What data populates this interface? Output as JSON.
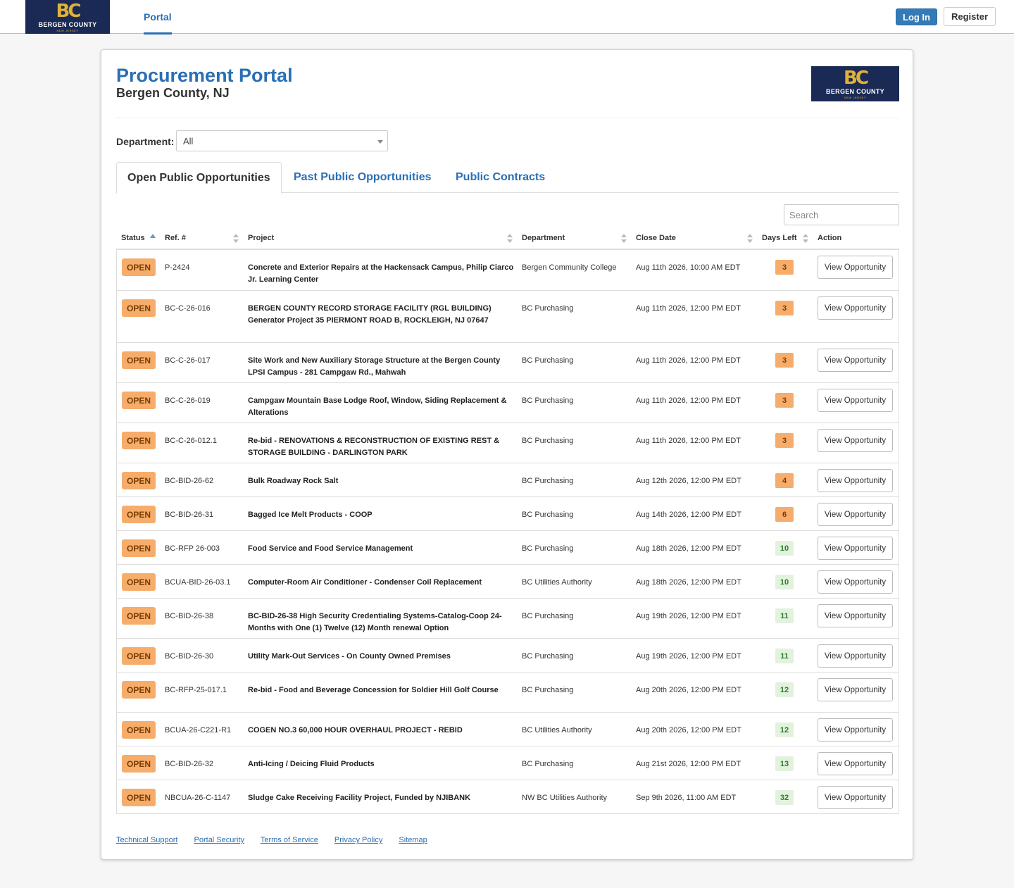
{
  "nav": {
    "logo": {
      "mark": "BC",
      "name": "BERGEN COUNTY",
      "sub": "NEW JERSEY"
    },
    "portal_link": "Portal",
    "login_label": "Log In",
    "register_label": "Register"
  },
  "header": {
    "title": "Procurement Portal",
    "subtitle": "Bergen County, NJ"
  },
  "filter": {
    "department_label": "Department:",
    "department_value": "All"
  },
  "tabs": [
    {
      "label": "Open Public Opportunities",
      "active": true
    },
    {
      "label": "Past Public Opportunities",
      "active": false
    },
    {
      "label": "Public Contracts",
      "active": false
    }
  ],
  "search": {
    "placeholder": "Search"
  },
  "table": {
    "columns": [
      "Status",
      "Ref. #",
      "Project",
      "Department",
      "Close Date",
      "Days Left",
      "Action"
    ],
    "action_label": "View Opportunity",
    "rows": [
      {
        "status": "OPEN",
        "ref": "P-2424",
        "project": "Concrete and Exterior Repairs at the Hackensack Campus, Philip Ciarco Jr. Learning Center",
        "dept": "Bergen Community College",
        "close": "Aug 11th 2026, 10:00 AM EDT",
        "days": "3",
        "urgent": true,
        "lines": 2
      },
      {
        "status": "OPEN",
        "ref": "BC-C-26-016",
        "project": "BERGEN COUNTY RECORD STORAGE FACILITY (RGL BUILDING) Generator Project 35 PIERMONT ROAD B, ROCKLEIGH, NJ 07647",
        "dept": "BC Purchasing",
        "close": "Aug 11th 2026, 12:00 PM EDT",
        "days": "3",
        "urgent": true,
        "lines": 3
      },
      {
        "status": "OPEN",
        "ref": "BC-C-26-017",
        "project": "Site Work and New Auxiliary Storage Structure at the Bergen County LPSI Campus - 281 Campgaw Rd., Mahwah",
        "dept": "BC Purchasing",
        "close": "Aug 11th 2026, 12:00 PM EDT",
        "days": "3",
        "urgent": true,
        "lines": 2
      },
      {
        "status": "OPEN",
        "ref": "BC-C-26-019",
        "project": "Campgaw Mountain Base Lodge Roof, Window, Siding Replacement & Alterations",
        "dept": "BC Purchasing",
        "close": "Aug 11th 2026, 12:00 PM EDT",
        "days": "3",
        "urgent": true,
        "lines": 2
      },
      {
        "status": "OPEN",
        "ref": "BC-C-26-012.1",
        "project": "Re-bid - RENOVATIONS & RECONSTRUCTION OF EXISTING REST & STORAGE BUILDING - DARLINGTON PARK",
        "dept": "BC Purchasing",
        "close": "Aug 11th 2026, 12:00 PM EDT",
        "days": "3",
        "urgent": true,
        "lines": 2
      },
      {
        "status": "OPEN",
        "ref": "BC-BID-26-62",
        "project": "Bulk Roadway Rock Salt",
        "dept": "BC Purchasing",
        "close": "Aug 12th 2026, 12:00 PM EDT",
        "days": "4",
        "urgent": true,
        "lines": 1
      },
      {
        "status": "OPEN",
        "ref": "BC-BID-26-31",
        "project": "Bagged Ice Melt Products - COOP",
        "dept": "BC Purchasing",
        "close": "Aug 14th 2026, 12:00 PM EDT",
        "days": "6",
        "urgent": true,
        "lines": 1
      },
      {
        "status": "OPEN",
        "ref": "BC-RFP 26-003",
        "project": "Food Service and Food Service Management",
        "dept": "BC Purchasing",
        "close": "Aug 18th 2026, 12:00 PM EDT",
        "days": "10",
        "urgent": false,
        "lines": 1
      },
      {
        "status": "OPEN",
        "ref": "BCUA-BID-26-03.1",
        "project": "Computer-Room Air Conditioner - Condenser Coil Replacement",
        "dept": "BC Utilities Authority",
        "close": "Aug 18th 2026, 12:00 PM EDT",
        "days": "10",
        "urgent": false,
        "lines": 1
      },
      {
        "status": "OPEN",
        "ref": "BC-BID-26-38",
        "project": "BC-BID-26-38 High Security Credentialing Systems-Catalog-Coop 24-Months with One (1) Twelve (12) Month renewal Option",
        "dept": "BC Purchasing",
        "close": "Aug 19th 2026, 12:00 PM EDT",
        "days": "11",
        "urgent": false,
        "lines": 2
      },
      {
        "status": "OPEN",
        "ref": "BC-BID-26-30",
        "project": "Utility Mark-Out Services - On County Owned Premises",
        "dept": "BC Purchasing",
        "close": "Aug 19th 2026, 12:00 PM EDT",
        "days": "11",
        "urgent": false,
        "lines": 1
      },
      {
        "status": "OPEN",
        "ref": "BC-RFP-25-017.1",
        "project": "Re-bid - Food and Beverage Concession for Soldier Hill Golf Course",
        "dept": "BC Purchasing",
        "close": "Aug 20th 2026, 12:00 PM EDT",
        "days": "12",
        "urgent": false,
        "lines": 2
      },
      {
        "status": "OPEN",
        "ref": "BCUA-26-C221-R1",
        "project": "COGEN NO.3 60,000 HOUR OVERHAUL PROJECT - REBID",
        "dept": "BC Utilities Authority",
        "close": "Aug 20th 2026, 12:00 PM EDT",
        "days": "12",
        "urgent": false,
        "lines": 1
      },
      {
        "status": "OPEN",
        "ref": "BC-BID-26-32",
        "project": "Anti-Icing / Deicing Fluid Products",
        "dept": "BC Purchasing",
        "close": "Aug 21st 2026, 12:00 PM EDT",
        "days": "13",
        "urgent": false,
        "lines": 1
      },
      {
        "status": "OPEN",
        "ref": "NBCUA-26-C-1147",
        "project": "Sludge Cake Receiving Facility Project, Funded by NJIBANK",
        "dept": "NW BC Utilities Authority",
        "close": "Sep 9th 2026, 11:00 AM EDT",
        "days": "32",
        "urgent": false,
        "lines": 1
      }
    ]
  },
  "footer": {
    "links": [
      "Technical Support",
      "Portal Security",
      "Terms of Service",
      "Privacy Policy",
      "Sitemap"
    ]
  },
  "colors": {
    "primary": "#2a6fb5",
    "brand_navy": "#1b2a55",
    "brand_gold": "#e0b23a",
    "badge_orange": "#f6ad6b",
    "badge_green": "#e2f2dd"
  }
}
